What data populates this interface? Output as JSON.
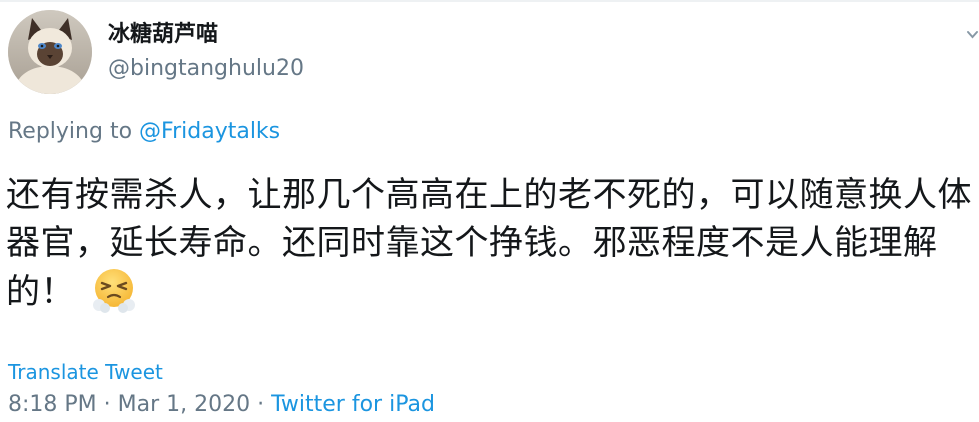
{
  "user": {
    "display_name": "冰糖葫芦喵",
    "handle": "@bingtanghulu20",
    "avatar": "cat-avatar"
  },
  "reply": {
    "prefix": "Replying to ",
    "mention": "@Fridaytalks"
  },
  "tweet": {
    "text": "还有按需杀人，让那几个高高在上的老不死的，可以随意换人体器官，延长寿命。还同时靠这个挣钱。邪恶程度不是人能理解的！",
    "emoji": "face-with-steam-from-nose"
  },
  "translate_label": "Translate Tweet",
  "meta": {
    "time": "8:18 PM",
    "separator1": " · ",
    "date": "Mar 1, 2020",
    "separator2": " · ",
    "source": "Twitter for iPad"
  },
  "colors": {
    "link": "#1b95e0",
    "secondary": "#657786",
    "text": "#14171a"
  }
}
